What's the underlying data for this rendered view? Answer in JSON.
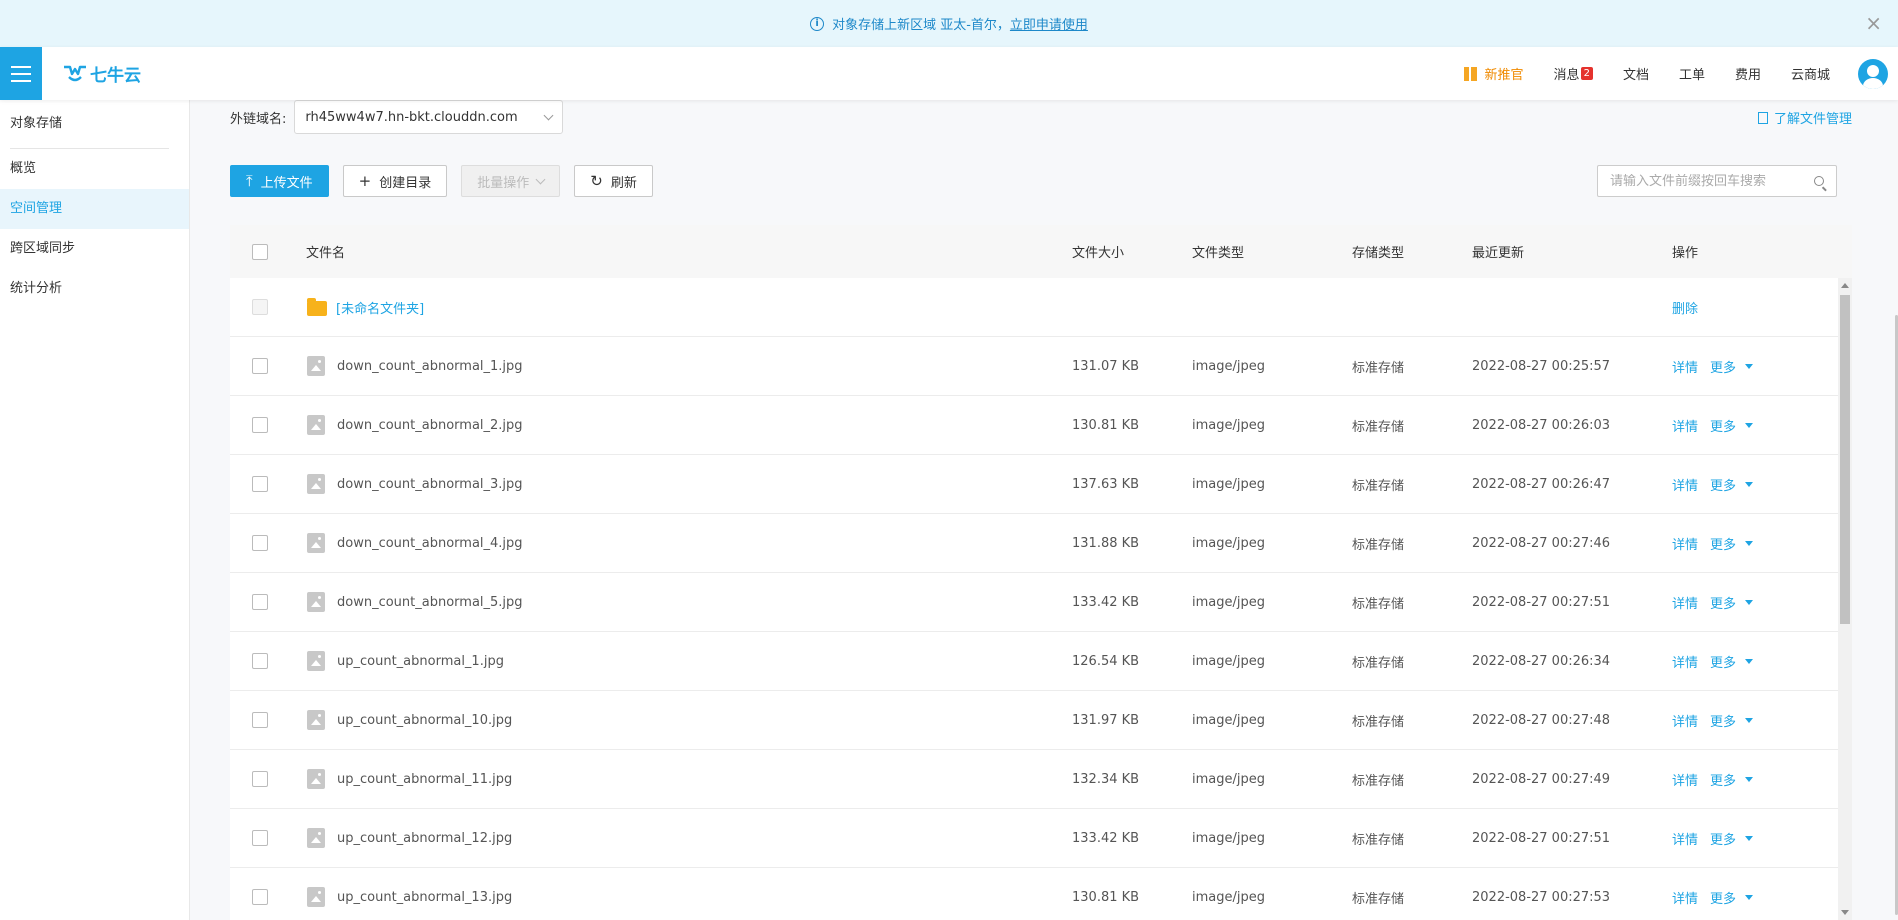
{
  "notice": {
    "text": "对象存储上新区域 亚太-首尔，",
    "link": "立即申请使用",
    "close": "×"
  },
  "topbar": {
    "logo_text": "七牛云",
    "nav": [
      {
        "label": "新推官"
      },
      {
        "label": "消息",
        "badge": "2"
      },
      {
        "label": "文档"
      },
      {
        "label": "工单"
      },
      {
        "label": "费用"
      },
      {
        "label": "云商城"
      }
    ]
  },
  "sidebar": {
    "title": "对象存储",
    "items": [
      {
        "label": "概览"
      },
      {
        "label": "空间管理",
        "active": true
      },
      {
        "label": "跨区域同步"
      },
      {
        "label": "统计分析"
      }
    ]
  },
  "main": {
    "domain_label": "外链域名:",
    "domain_value": "rh45ww4w7.hn-bkt.clouddn.com",
    "learn_link": "了解文件管理",
    "toolbar": {
      "upload": "上传文件",
      "create_dir": "创建目录",
      "batch": "批量操作",
      "refresh": "刷新",
      "search_placeholder": "请输入文件前缀按回车搜索"
    },
    "table": {
      "headers": {
        "name": "文件名",
        "size": "文件大小",
        "type": "文件类型",
        "storage": "存储类型",
        "updated": "最近更新",
        "ops": "操作"
      },
      "folder": {
        "name": "[未命名文件夹]",
        "delete": "删除"
      },
      "op_detail": "详情",
      "op_more": "更多",
      "rows": [
        {
          "name": "down_count_abnormal_1.jpg",
          "size": "131.07 KB",
          "type": "image/jpeg",
          "storage": "标准存储",
          "updated": "2022-08-27 00:25:57"
        },
        {
          "name": "down_count_abnormal_2.jpg",
          "size": "130.81 KB",
          "type": "image/jpeg",
          "storage": "标准存储",
          "updated": "2022-08-27 00:26:03"
        },
        {
          "name": "down_count_abnormal_3.jpg",
          "size": "137.63 KB",
          "type": "image/jpeg",
          "storage": "标准存储",
          "updated": "2022-08-27 00:26:47"
        },
        {
          "name": "down_count_abnormal_4.jpg",
          "size": "131.88 KB",
          "type": "image/jpeg",
          "storage": "标准存储",
          "updated": "2022-08-27 00:27:46"
        },
        {
          "name": "down_count_abnormal_5.jpg",
          "size": "133.42 KB",
          "type": "image/jpeg",
          "storage": "标准存储",
          "updated": "2022-08-27 00:27:51"
        },
        {
          "name": "up_count_abnormal_1.jpg",
          "size": "126.54 KB",
          "type": "image/jpeg",
          "storage": "标准存储",
          "updated": "2022-08-27 00:26:34"
        },
        {
          "name": "up_count_abnormal_10.jpg",
          "size": "131.97 KB",
          "type": "image/jpeg",
          "storage": "标准存储",
          "updated": "2022-08-27 00:27:48"
        },
        {
          "name": "up_count_abnormal_11.jpg",
          "size": "132.34 KB",
          "type": "image/jpeg",
          "storage": "标准存储",
          "updated": "2022-08-27 00:27:49"
        },
        {
          "name": "up_count_abnormal_12.jpg",
          "size": "133.42 KB",
          "type": "image/jpeg",
          "storage": "标准存储",
          "updated": "2022-08-27 00:27:51"
        },
        {
          "name": "up_count_abnormal_13.jpg",
          "size": "130.81 KB",
          "type": "image/jpeg",
          "storage": "标准存储",
          "updated": "2022-08-27 00:27:53"
        }
      ]
    }
  }
}
